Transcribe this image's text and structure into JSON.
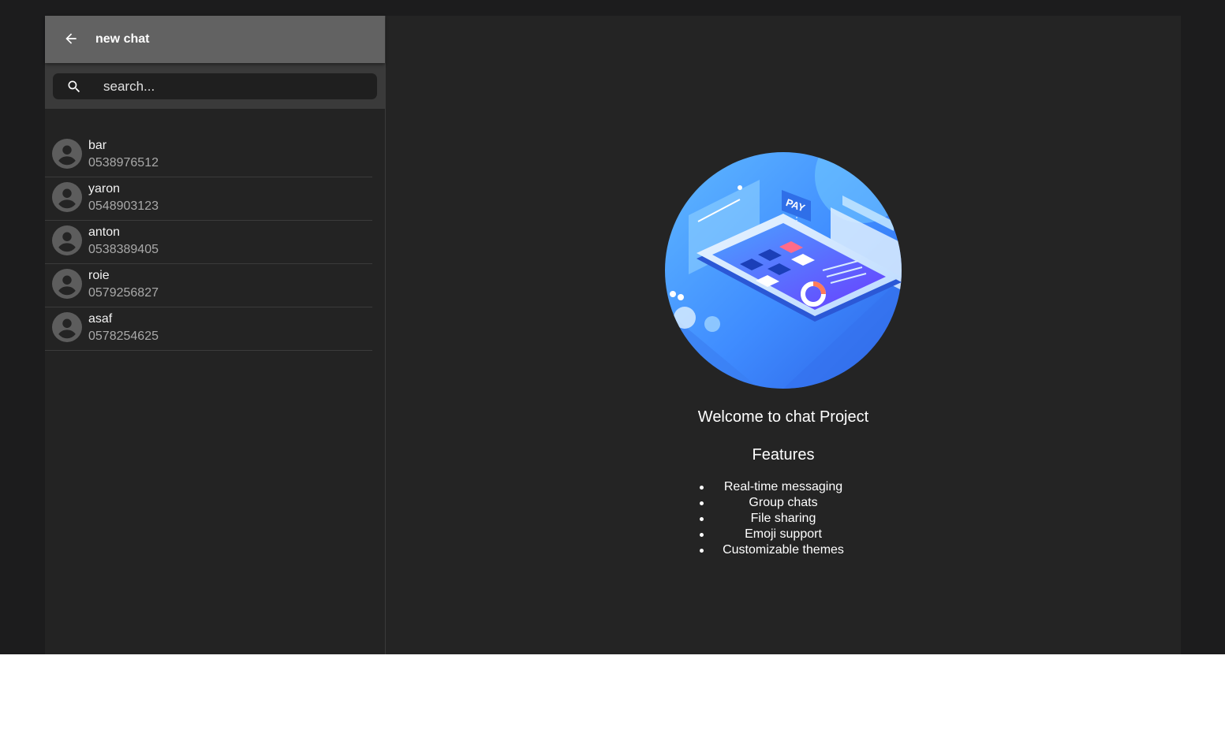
{
  "sidebar": {
    "title": "new chat",
    "search_placeholder": "search...",
    "contacts": [
      {
        "name": "bar",
        "phone": "0538976512"
      },
      {
        "name": "yaron",
        "phone": "0548903123"
      },
      {
        "name": "anton",
        "phone": "0538389405"
      },
      {
        "name": "roie",
        "phone": "0579256827"
      },
      {
        "name": "asaf",
        "phone": "0578254625"
      }
    ]
  },
  "main": {
    "hero_image_text": "PAY",
    "welcome": "Welcome to chat Project",
    "features_title": "Features",
    "features": [
      "Real-time messaging",
      "Group chats",
      "File sharing",
      "Emoji support",
      "Customizable themes"
    ]
  },
  "icons": {
    "back": "arrow-left-icon",
    "search": "search-icon",
    "avatar": "account-circle-icon"
  },
  "colors": {
    "header_bg": "#626262",
    "sidebar_bg": "#232323",
    "main_bg": "#242424",
    "search_bg": "#1f1f1f",
    "accent_blue": "#3f8cff"
  }
}
